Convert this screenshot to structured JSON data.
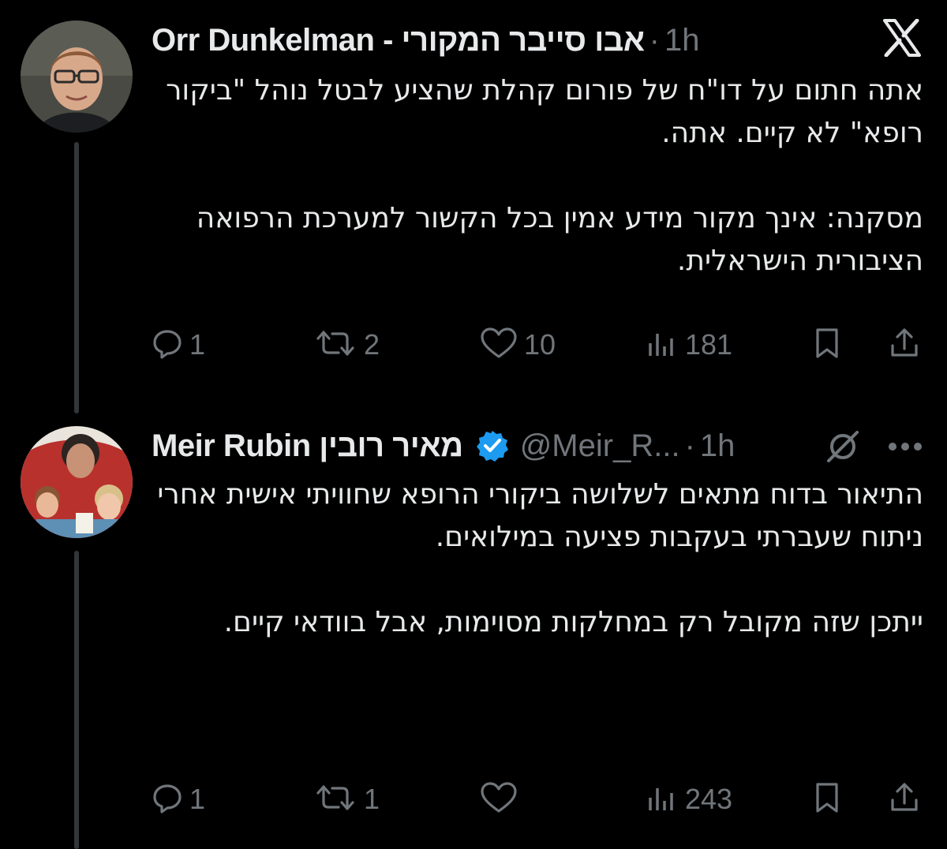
{
  "tweets": [
    {
      "display_name": "Orr Dunkelman - אבו סייבר המקורי",
      "handle": "",
      "dot": "·",
      "time": "1h",
      "paragraphs": [
        "אתה חתום על דו\"ח של פורום קהלת שהציע לבטל נוהל \"ביקור רופא\" לא קיים. אתה.",
        "מסקנה: אינך מקור מידע אמין בכל הקשור למערכת הרפואה הציבורית הישראלית."
      ],
      "actions": {
        "replies": "1",
        "reposts": "2",
        "likes": "10",
        "views": "181"
      }
    },
    {
      "display_name": "Meir Rubin מאיר רובין",
      "handle": "@Meir_R...",
      "dot": "·",
      "time": "1h",
      "paragraphs": [
        "התיאור בדוח מתאים לשלושה ביקורי הרופא שחוויתי אישית אחרי ניתוח שעברתי בעקבות פציעה במילואים.",
        "ייתכן שזה מקובל רק במחלקות מסוימות, אבל בוודאי קיים."
      ],
      "actions": {
        "replies": "1",
        "reposts": "1",
        "likes": "",
        "views": "243"
      }
    }
  ],
  "icons": {
    "top_right_1": "x-logo-icon",
    "top_right_2": "grok-icon",
    "more": "more-icon",
    "verified": "verified-badge-icon",
    "reply": "reply-icon",
    "repost": "repost-icon",
    "like": "heart-icon",
    "views": "views-icon",
    "bookmark": "bookmark-icon",
    "share": "share-icon"
  },
  "colors": {
    "background": "#000000",
    "text": "#e7e9ea",
    "muted": "#71767b",
    "verified": "#1d9bf0",
    "thread_line": "#333639"
  }
}
